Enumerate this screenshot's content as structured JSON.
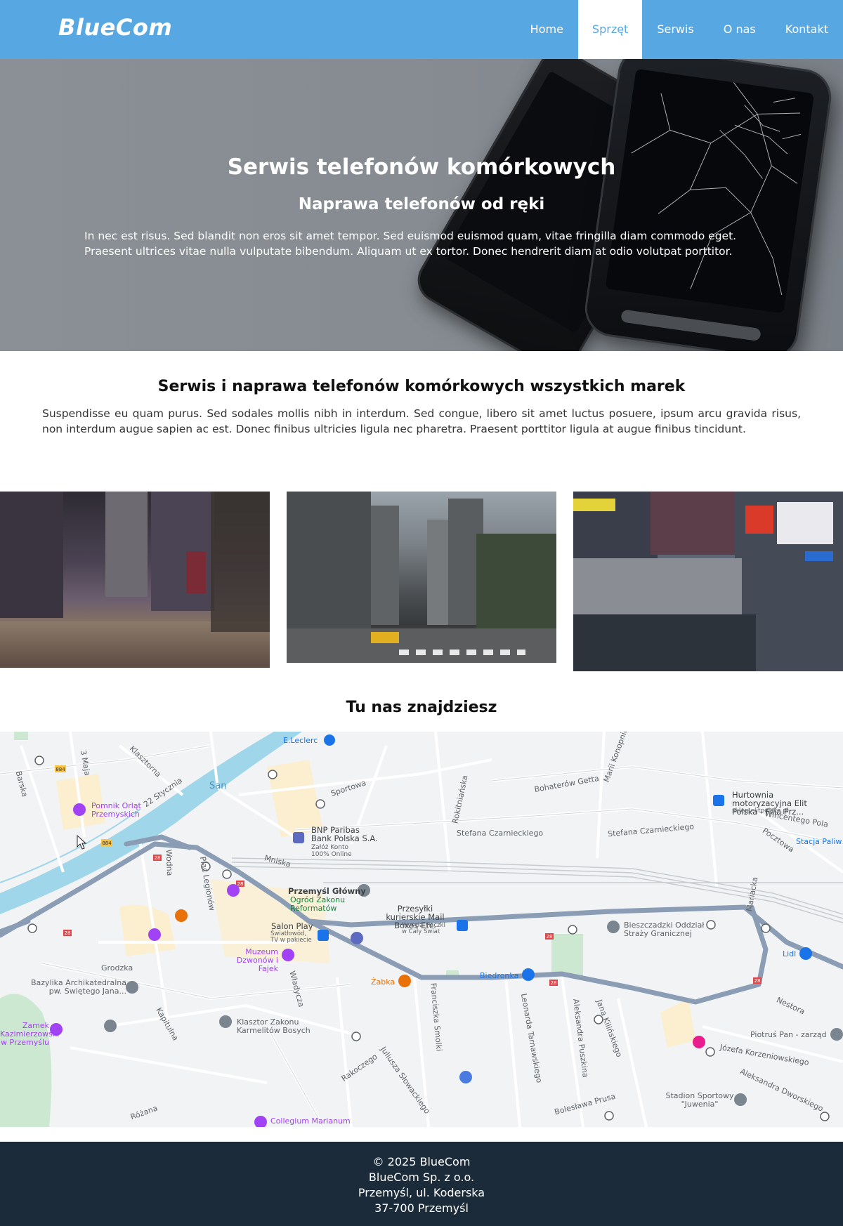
{
  "nav": {
    "brand": "BlueCom",
    "items": [
      {
        "label": "Home",
        "active": false
      },
      {
        "label": "Sprzęt",
        "active": true
      },
      {
        "label": "Serwis",
        "active": false
      },
      {
        "label": "O nas",
        "active": false
      },
      {
        "label": "Kontakt",
        "active": false
      }
    ]
  },
  "hero": {
    "title": "Serwis telefonów komórkowych",
    "subtitle": "Naprawa telefonów od ręki",
    "text": "In nec est risus. Sed blandit non eros sit amet tempor. Sed euismod euismod quam, vitae fringilla diam commodo eget. Praesent ultrices vitae nulla vulputate bibendum. Aliquam ut ex tortor. Donec hendrerit diam at odio volutpat porttitor."
  },
  "section": {
    "title": "Serwis i naprawa telefonów komórkowych wszystkich marek",
    "text": "Suspendisse eu quam purus. Sed sodales mollis nibh in interdum. Sed congue, libero sit amet luctus posuere, ipsum arcu gravida risus, non interdum augue sapien ac est. Donec finibus ultricies ligula nec pharetra. Praesent porttitor ligula at augue finibus tincidunt."
  },
  "map": {
    "title": "Tu nas znajdziesz",
    "labels": {
      "leclerc": "E.Leclerc",
      "san": "San",
      "majа": "3 Maja",
      "klasztorna": "Klasztorna",
      "stycznia": "22 Stycznia",
      "barska": "Barska",
      "pomnik": "Pomnik Orląt Przemyskich",
      "sportowa": "Sportowa",
      "bnp": "BNP Paribas Bank Polska S.A.",
      "bnp_sub": "Załóż Konto 100% Online",
      "rokitnianska": "Rokitniańska",
      "bohaterow": "Bohaterów Getta",
      "marii": "Marii Konopnickiej",
      "hurtownia": "Hurtownia motoryzacyjna Elit Polska - Filia Prz...",
      "hurtownia_sub": "sklep.elitpolska.pl",
      "stefana1": "Stefana Czarnieckiego",
      "stefana2": "Stefana Czarnieckiego",
      "wincentego": "Wincentego Pola",
      "pocztowa": "Pocztowa",
      "stacja": "Stacja Paliw",
      "mniska": "Mniska",
      "dworzec": "Przemyśl Główny",
      "ogrod": "Ogród Zakonu Reformatów",
      "przesylki": "Przesyłki kurierskie Mail Boxes Etc.",
      "przesylki_sub": "Wysyłaj Paczki w Cały Świat",
      "salon": "Salon Play",
      "salon_sub": "Światłowód, TV w pakiecie",
      "bieszczadzki": "Bieszczadzki Oddział Straży Granicznej",
      "lidl": "Lidl",
      "wodna": "Wodna",
      "plac": "Plac Legionów",
      "grodzka": "Grodzka",
      "muzeum": "Muzeum Dzwonów i Fajek",
      "zabka": "Żabka",
      "biedronka": "Biedronka",
      "bazylika": "Bazylika Archikatedralna pw. Świętego Jana...",
      "zamek": "Zamek Kazimierzowski w Przemyślu",
      "kapitulna": "Kapitulna",
      "karmelici": "Klasztor Zakonu Karmelitów Bosych",
      "wladycza": "Władycza",
      "rakoczego": "Rakoczego",
      "slowackiego": "Juliusza Słowackiego",
      "smolki": "Franciszka Smolki",
      "tarnawskiego": "Leonarda Tarnawskiego",
      "puszkina": "Aleksandra Puszkina",
      "kilinskiego": "Jana Kilińskiego",
      "prusa": "Bolesława Prusa",
      "nestora": "Nestora",
      "piotrus": "Piotruś Pan - zarząd",
      "korzeniowskiego": "Józefa Korzeniowskiego",
      "dworskiego": "Aleksandra Dworskiego",
      "stadion": "Stadion Sportowy \"Juwenia\"",
      "rozana": "Różana",
      "collegium": "Collegium Marianum",
      "matacka": "Mariacka"
    },
    "route_labels": [
      "884",
      "884",
      "28",
      "28",
      "28",
      "28",
      "28",
      "28"
    ]
  },
  "footer": {
    "line1": "© 2025 BlueCom",
    "line2": "BlueCom Sp. z o.o.",
    "line3": "Przemyśl, ul. Koderska",
    "line4": "37-700 Przemyśl"
  }
}
